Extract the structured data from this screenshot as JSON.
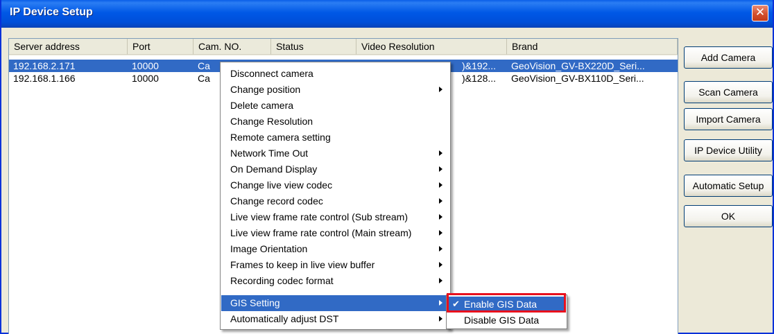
{
  "window": {
    "title": "IP Device Setup",
    "close_label": "✕"
  },
  "columns": [
    "Server address",
    "Port",
    "Cam. NO.",
    "Status",
    "Video Resolution",
    "Brand"
  ],
  "rows": [
    {
      "server": "192.168.2.171",
      "port": "10000",
      "cam": "Ca",
      "status": "",
      "resolution": ")&192...",
      "brand": "GeoVision_GV-BX220D_Seri..."
    },
    {
      "server": "192.168.1.166",
      "port": "10000",
      "cam": "Ca",
      "status": "",
      "resolution": ")&128...",
      "brand": "GeoVision_GV-BX110D_Seri..."
    }
  ],
  "buttons": [
    "Add Camera",
    "Scan Camera",
    "Import Camera",
    "IP Device Utility",
    "Automatic Setup",
    "OK"
  ],
  "context_menu": [
    {
      "label": "Disconnect camera",
      "submenu": false
    },
    {
      "label": "Change position",
      "submenu": true
    },
    {
      "label": "Delete camera",
      "submenu": false
    },
    {
      "label": "Change Resolution",
      "submenu": false
    },
    {
      "label": "Remote camera setting",
      "submenu": false
    },
    {
      "label": "Network Time Out",
      "submenu": true
    },
    {
      "label": "On Demand Display",
      "submenu": true
    },
    {
      "label": "Change live view codec",
      "submenu": true
    },
    {
      "label": "Change record codec",
      "submenu": true
    },
    {
      "label": "Live view frame rate control (Sub stream)",
      "submenu": true
    },
    {
      "label": "Live view frame rate control (Main stream)",
      "submenu": true
    },
    {
      "label": "Image Orientation",
      "submenu": true
    },
    {
      "label": "Frames to keep in live view buffer",
      "submenu": true
    },
    {
      "label": "Recording codec format",
      "submenu": true
    },
    {
      "label": "GIS Setting",
      "submenu": true,
      "highlighted": true
    },
    {
      "label": "Automatically adjust DST",
      "submenu": true
    }
  ],
  "gis_submenu": [
    {
      "label": "Enable GIS Data",
      "checked": true,
      "highlighted": true
    },
    {
      "label": "Disable  GIS Data",
      "checked": false
    }
  ],
  "check_icon": "checkmark-icon",
  "colors": {
    "selection": "#316ac5",
    "titlebar": "#0058e6",
    "annotation": "#e8101d"
  }
}
